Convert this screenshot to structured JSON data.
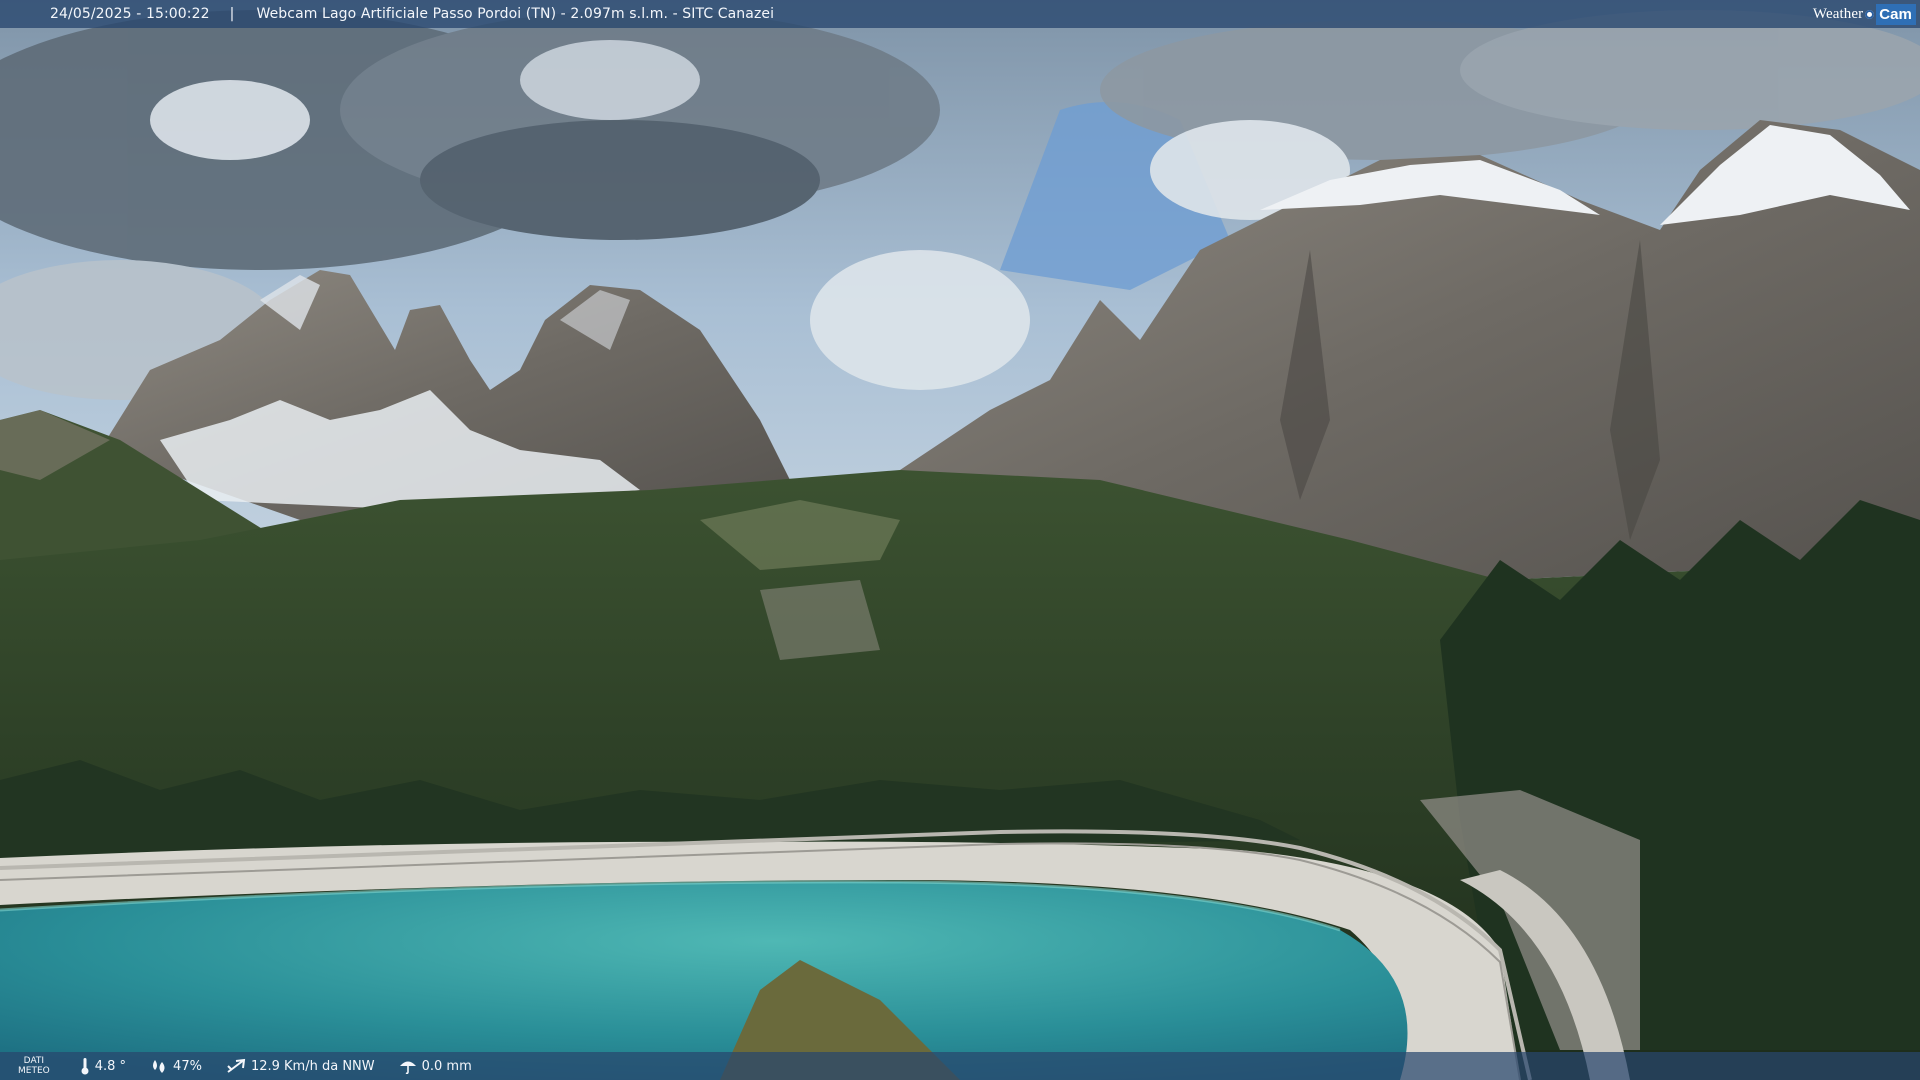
{
  "header": {
    "timestamp": "24/05/2025 - 15:00:22",
    "separator": "|",
    "title": "Webcam Lago Artificiale Passo Pordoi (TN) - 2.097m s.l.m. - SITC Canazei",
    "brand_left": "Weather",
    "brand_right": "Cam"
  },
  "footer": {
    "label_line1": "DATI",
    "label_line2": "METEO",
    "temperature": "4.8 °",
    "humidity": "47%",
    "wind": "12.9 Km/h da NNW",
    "rain": "0.0 mm",
    "icons": [
      "thermometer-icon",
      "humidity-icon",
      "wind-icon",
      "rain-icon"
    ]
  },
  "colors": {
    "bar_bg": "#28466e",
    "brand_accent": "#2f6fb5",
    "lake": "#2f9aa0",
    "sky": "#8fb1d4"
  }
}
